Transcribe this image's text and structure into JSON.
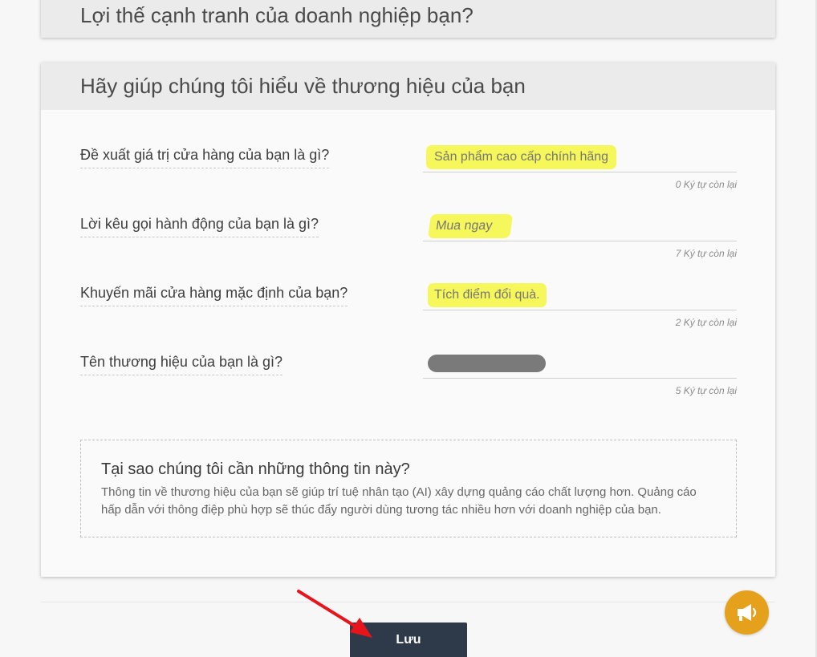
{
  "cards": {
    "competitive": {
      "title": "Lợi thế cạnh tranh của doanh nghiệp bạn?"
    },
    "brand": {
      "title": "Hãy giúp chúng tôi hiểu về thương hiệu của bạn",
      "fields": [
        {
          "label": "Đề xuất giá trị cửa hàng của bạn là gì?",
          "value": "Sản phẩm cao cấp chính hãng",
          "counter": "0 Ký tự còn lại"
        },
        {
          "label": "Lời kêu gọi hành động của bạn là gì?",
          "value": "Mua ngay",
          "counter": "7 Ký tự còn lại"
        },
        {
          "label": "Khuyến mãi cửa hàng mặc định của bạn?",
          "value": "Tích điểm đổi quà.",
          "counter": "2 Ký tự còn lại"
        },
        {
          "label": "Tên thương hiệu của bạn là gì?",
          "value": "",
          "counter": "5 Ký tự còn lại"
        }
      ],
      "info": {
        "title": "Tại sao chúng tôi cần những thông tin này?",
        "body": "Thông tin về thương hiệu của bạn sẽ giúp trí tuệ nhân tạo (AI) xây dựng quảng cáo chất lượng hơn. Quảng cáo hấp dẫn với thông điệp phù hợp sẽ thúc đẩy người dùng tương tác nhiều hơn với doanh nghiệp của bạn."
      }
    }
  },
  "footer": {
    "save_label": "Lưu"
  },
  "icons": {
    "fab": "megaphone-icon",
    "annotation": "red-arrow"
  },
  "colors": {
    "highlight": "#f6f75a",
    "save_button": "#2e3a4a",
    "fab": "#e5a11c",
    "annotation_arrow": "#e8141c"
  }
}
